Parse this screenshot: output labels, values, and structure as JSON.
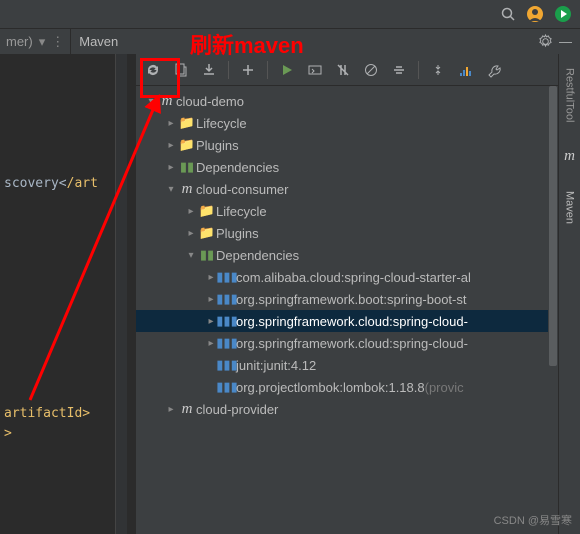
{
  "annotation_text": "刷新maven",
  "topbar": {
    "search_icon": "search",
    "profile": "avatar"
  },
  "editor_tab": {
    "label": "mer)"
  },
  "maven_header": {
    "title": "Maven"
  },
  "code": {
    "line1_prefix": "scovery<",
    "line1_tag": "/art",
    "line2_text": "artifactId>",
    "line3_text": ">"
  },
  "tree": {
    "root": "cloud-demo",
    "lifecycle": "Lifecycle",
    "plugins": "Plugins",
    "dependencies": "Dependencies",
    "consumer": "cloud-consumer",
    "consumer_lifecycle": "Lifecycle",
    "consumer_plugins": "Plugins",
    "consumer_dependencies": "Dependencies",
    "dep1": "com.alibaba.cloud:spring-cloud-starter-al",
    "dep2": "org.springframework.boot:spring-boot-st",
    "dep3": "org.springframework.cloud:spring-cloud-",
    "dep4": "org.springframework.cloud:spring-cloud-",
    "dep5": "junit:junit:4.12",
    "dep6_a": "org.projectlombok:lombok:1.18.8",
    "dep6_b": " (provic",
    "provider": "cloud-provider"
  },
  "sidebar": {
    "restful": "RestfulTool",
    "maven": "Maven"
  },
  "watermark": "CSDN @易雪寒"
}
